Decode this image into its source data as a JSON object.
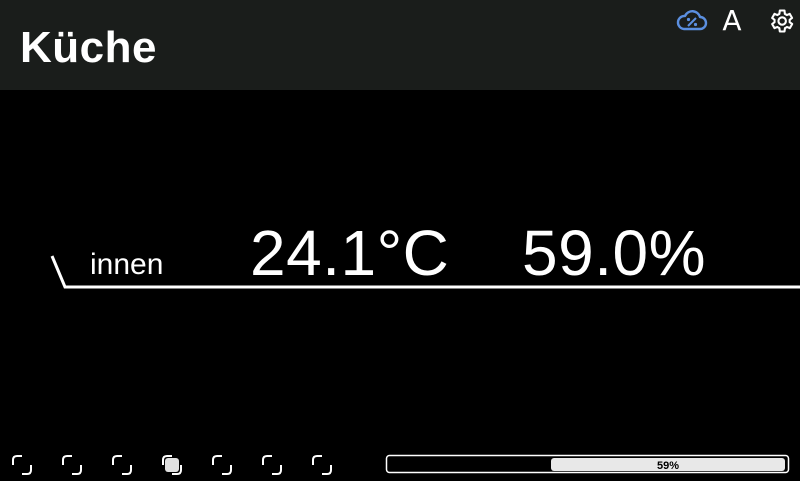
{
  "header": {
    "title": "Küche",
    "icons": [
      "cloud-percent-icon",
      "font-a-icon",
      "gear-icon"
    ],
    "font_label": "A"
  },
  "reading": {
    "label": "innen",
    "temperature": "24.1°C",
    "humidity": "59.0%"
  },
  "pages": {
    "count": 7,
    "active_index": 3
  },
  "progress": {
    "value": 0.59,
    "label": "59%"
  },
  "colors": {
    "background": "#000000",
    "header": "#1a1d1b",
    "text": "#ffffff",
    "cloud_icon": "#5b8fe0",
    "progress_fill": "#e8e8e8"
  }
}
